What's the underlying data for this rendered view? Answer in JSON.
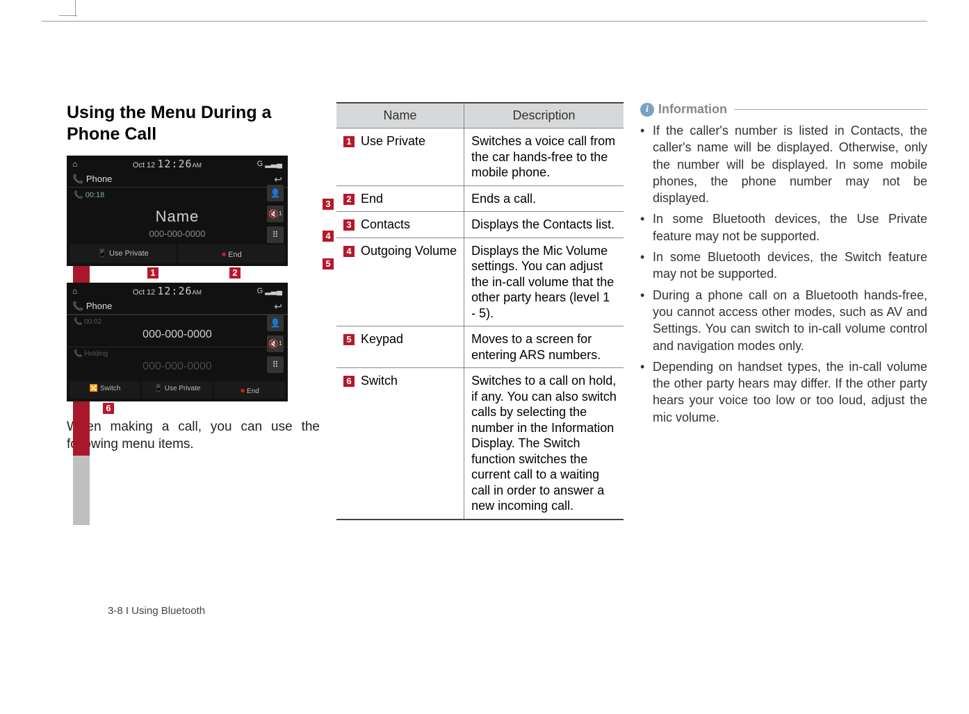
{
  "section_title": "Using the Menu During a Phone Call",
  "screenshot_a": {
    "date": "Oct 12",
    "time": "12:26",
    "ampm": "AM",
    "signal": "G ▂▃▄",
    "tab": "Phone",
    "duration": "00:18",
    "name_label": "Name",
    "number": "000-000-0000",
    "btn_use_private": "Use Private",
    "btn_end": "End",
    "side_contacts_icon": "contacts-icon",
    "side_volume_icon": "volume-icon",
    "side_keypad_icon": "keypad-icon"
  },
  "screenshot_b": {
    "date": "Oct 12",
    "time": "12:26",
    "ampm": "AM",
    "signal": "G ▂▃▄",
    "tab": "Phone",
    "duration": "00:02",
    "active_number": "000-000-0000",
    "holding_label": "Holding",
    "holding_number": "000-000-0000",
    "btn_switch": "Switch",
    "btn_use_private": "Use Private",
    "btn_end": "End"
  },
  "callouts": {
    "c1": "1",
    "c2": "2",
    "c3": "3",
    "c4": "4",
    "c5": "5",
    "c6": "6"
  },
  "body_text": "When making a call, you can use the following menu items.",
  "table": {
    "head_name": "Name",
    "head_desc": "Description",
    "rows": [
      {
        "num": "1",
        "name": "Use Private",
        "desc": "Switches a voice call from the car hands-free to the mobile phone."
      },
      {
        "num": "2",
        "name": "End",
        "desc": "Ends a call."
      },
      {
        "num": "3",
        "name": "Contacts",
        "desc": "Displays the Contacts list."
      },
      {
        "num": "4",
        "name": "Outgoing Volume",
        "desc": "Displays the Mic Volume settings. You can adjust the in-call volume that the other party hears (level 1 - 5)."
      },
      {
        "num": "5",
        "name": "Keypad",
        "desc": "Moves to a screen for entering ARS numbers."
      },
      {
        "num": "6",
        "name": "Switch",
        "desc": "Switches to a call on hold, if any.  You can also switch calls by selecting the number in the Information Display. The Switch function switches the current call to a waiting call in order to answer a new incoming call."
      }
    ]
  },
  "info": {
    "heading": "Information",
    "items": [
      "If the caller's number is listed in Contacts, the caller's name will be displayed. Otherwise, only the number will be displayed. In some mobile phones, the phone number may not be displayed.",
      "In some Bluetooth devices, the Use Private feature may not be supported.",
      "In some Bluetooth devices, the Switch feature may not be supported.",
      "During a phone call on a Bluetooth hands-free, you cannot access other modes, such as AV and Settings. You can switch to in-call volume control and navigation modes only.",
      "Depending on handset types, the in-call volume the other party hears may differ. If the other party hears your voice too low or too loud, adjust the mic volume."
    ]
  },
  "footer": "3-8 I Using Bluetooth"
}
